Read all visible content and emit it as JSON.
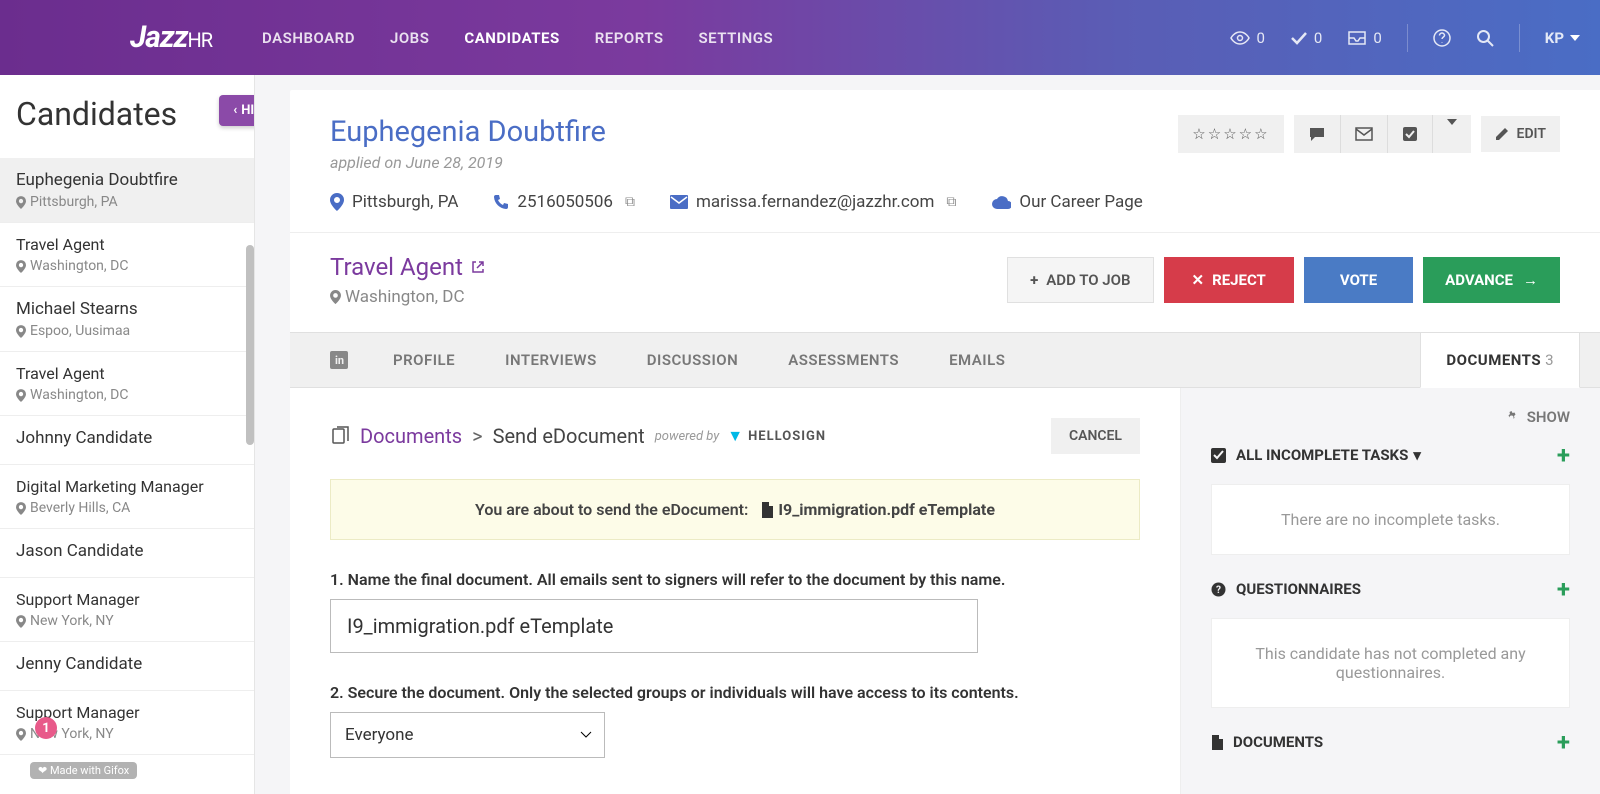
{
  "nav": {
    "logo_main": "Jazz",
    "logo_sub": "HR",
    "items": [
      "DASHBOARD",
      "JOBS",
      "CANDIDATES",
      "REPORTS",
      "SETTINGS"
    ],
    "active_index": 2,
    "stats": {
      "eye": "0",
      "check": "0",
      "inbox": "0"
    },
    "user": "KP"
  },
  "sidebar": {
    "title": "Candidates",
    "hide_label": "HIDE",
    "items": [
      {
        "name": "Euphegenia Doubtfire",
        "loc": "Pittsburgh, PA",
        "active": true
      },
      {
        "name": "Travel Agent",
        "loc": "Washington, DC",
        "sub": true
      },
      {
        "name": "Michael Stearns",
        "loc": "Espoo, Uusimaa"
      },
      {
        "name": "Travel Agent",
        "loc": "Washington, DC",
        "sub": true
      },
      {
        "name": "Johnny Candidate",
        "loc": ""
      },
      {
        "name": "Digital Marketing Manager",
        "loc": "Beverly Hills, CA",
        "sub": true
      },
      {
        "name": "Jason Candidate",
        "loc": ""
      },
      {
        "name": "Support Manager",
        "loc": "New York, NY",
        "sub": true
      },
      {
        "name": "Jenny Candidate",
        "loc": ""
      },
      {
        "name": "Support Manager",
        "loc": "New York, NY",
        "sub": true
      }
    ],
    "badge": "1",
    "gifox": "Made with Gifox"
  },
  "candidate": {
    "name": "Euphegenia Doubtfire",
    "applied": "applied on June 28, 2019",
    "location": "Pittsburgh, PA",
    "phone": "2516050506",
    "email": "marissa.fernandez@jazzhr.com",
    "source": "Our Career Page",
    "edit_label": "EDIT",
    "job_title": "Travel Agent",
    "job_loc": "Washington, DC",
    "add_to_job": "ADD TO JOB",
    "reject": "REJECT",
    "vote": "VOTE",
    "advance": "ADVANCE"
  },
  "tabs": {
    "items": [
      "PROFILE",
      "INTERVIEWS",
      "DISCUSSION",
      "ASSESSMENTS",
      "EMAILS"
    ],
    "active_label": "DOCUMENTS",
    "active_count": "3"
  },
  "docs": {
    "link": "Documents",
    "current": "Send eDocument",
    "powered": "powered by",
    "hellosign": "HELLOSIGN",
    "cancel": "CANCEL",
    "alert_prefix": "You are about to send the eDocument:",
    "alert_file": "I9_immigration.pdf eTemplate",
    "step1_label": "1. Name the final document. All emails sent to signers will refer to the document by this name.",
    "step1_value": "I9_immigration.pdf eTemplate",
    "step2_label": "2. Secure the document. Only the selected groups or individuals will have access to its contents.",
    "step2_value": "Everyone"
  },
  "right": {
    "show": "SHOW",
    "tasks_header": "ALL INCOMPLETE TASKS",
    "tasks_body": "There are no incomplete tasks.",
    "quest_header": "QUESTIONNAIRES",
    "quest_body": "This candidate has not completed any questionnaires.",
    "docs_header": "DOCUMENTS"
  }
}
